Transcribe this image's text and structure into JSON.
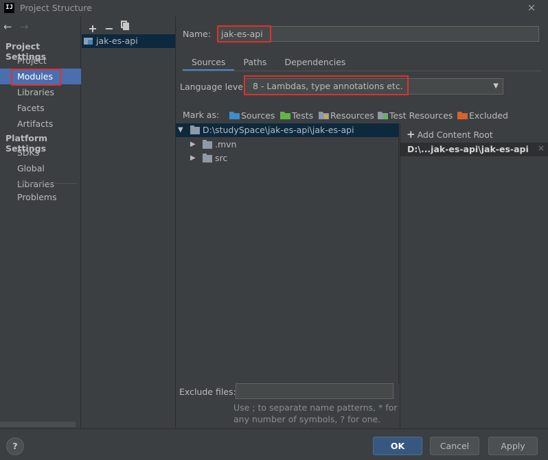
{
  "window": {
    "app_icon_text": "IJ",
    "title": "Project Structure",
    "close_icon": "×"
  },
  "sidebar": {
    "back_icon": "←",
    "forward_icon": "→",
    "project_settings_header": "Project Settings",
    "project_settings_items": [
      {
        "label": "Project"
      },
      {
        "label": "Modules",
        "selected": true
      },
      {
        "label": "Libraries"
      },
      {
        "label": "Facets"
      },
      {
        "label": "Artifacts"
      }
    ],
    "platform_settings_header": "Platform Settings",
    "platform_settings_items": [
      {
        "label": "SDKs"
      },
      {
        "label": "Global Libraries"
      }
    ],
    "problems_label": "Problems"
  },
  "module_list": {
    "add_icon": "+",
    "remove_icon": "−",
    "modules": [
      {
        "label": "jak-es-api"
      }
    ]
  },
  "module_editor": {
    "name_label": "Name:",
    "name_value": "jak-es-api",
    "tabs": [
      {
        "label": "Sources",
        "active": true
      },
      {
        "label": "Paths"
      },
      {
        "label": "Dependencies"
      }
    ],
    "language_level_label": "Language level:",
    "language_level_value": "8 - Lambdas, type annotations etc.",
    "mark_as_label": "Mark as:",
    "mark_as": [
      {
        "label": "Sources",
        "color": "#3d8ec9"
      },
      {
        "label": "Tests",
        "color": "#62b543"
      },
      {
        "label": "Resources",
        "color": "#8e9aa6"
      },
      {
        "label": "Test Resources",
        "color": "#8e9aa6"
      },
      {
        "label": "Excluded",
        "color": "#d9622b"
      }
    ],
    "tree": {
      "root": "D:\\studySpace\\jak-es-api\\jak-es-api",
      "children": [
        ".mvn",
        "src"
      ]
    },
    "content_roots": {
      "add_label": "Add Content Root",
      "root_label": "D:\\...jak-es-api\\jak-es-api",
      "remove_icon": "×"
    },
    "exclude_files_label": "Exclude files:",
    "exclude_files_value": "",
    "exclude_hint_line1": "Use ; to separate name patterns, * for",
    "exclude_hint_line2": "any number of symbols, ? for one."
  },
  "footer": {
    "help_label": "?",
    "ok_label": "OK",
    "cancel_label": "Cancel",
    "apply_label": "Apply"
  },
  "highlight_color": "#e0312c"
}
